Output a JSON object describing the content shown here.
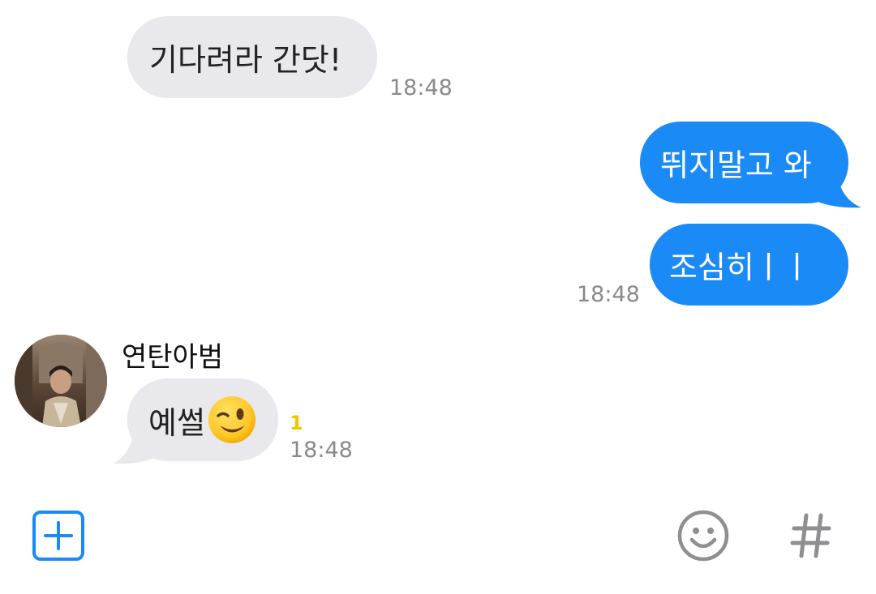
{
  "messages": [
    {
      "text": "기다려라 간닷!",
      "time": "18:48"
    },
    {
      "text": "뛰지말고 와"
    },
    {
      "text": "조심히ㅣㅣ",
      "time": "18:48"
    },
    {
      "sender": "연탄아범",
      "text": "예썰",
      "emoji": "wink-emoji",
      "unread": "1",
      "time": "18:48"
    }
  ],
  "composer": {
    "add_icon": "plus-square-icon",
    "emoji_icon": "smiley-icon",
    "hashtag_icon": "hash-icon"
  },
  "colors": {
    "outgoing_bubble": "#1a8af7",
    "incoming_bubble": "#e8e8ed",
    "unread_count": "#f2c500",
    "accent": "#1a8af7"
  }
}
